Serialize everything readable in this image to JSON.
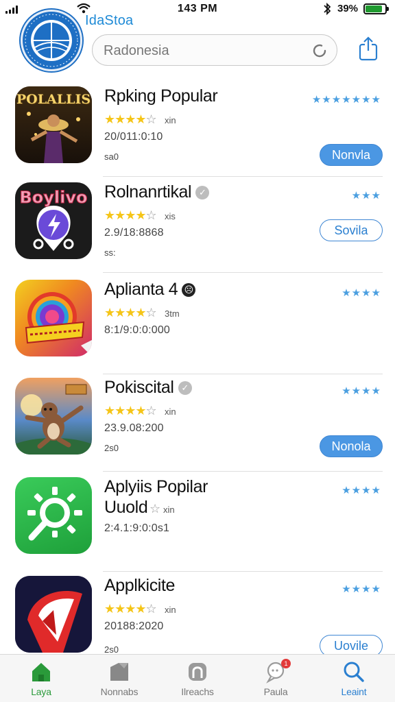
{
  "status_bar": {
    "time": "143 PM",
    "battery_percent": "39%",
    "battery_level": 0.85
  },
  "header": {
    "store_name": "IdaStoa"
  },
  "search": {
    "value": "Radonesia"
  },
  "apps": [
    {
      "name": "Rpking Popular",
      "name_line2": "",
      "rating_stars": 4,
      "rating_count": "xin",
      "meta": "20/011:0:10",
      "size": "sa0",
      "button": "Nonvla",
      "button_style": "filled",
      "icon": "app-icon-polallis",
      "icon_text": "POLALLIS",
      "right_stars": "★★★★★★★"
    },
    {
      "name": "Rolnanrtikal",
      "name_line2": "",
      "rating_stars": 4,
      "rating_count": "xis",
      "meta": "2.9/18:8868",
      "size": "ss:",
      "button": "Sovila",
      "button_style": "outline",
      "icon": "app-icon-boylivo",
      "icon_text": "Boylivo",
      "right_stars": "★★★"
    },
    {
      "name": "Aplianta 4",
      "name_line2": "",
      "rating_stars": 4,
      "rating_count": "3tm",
      "meta": "8:1/9:0:0:000",
      "size": "",
      "button": "",
      "button_style": "none",
      "icon": "app-icon-rainbow",
      "icon_text": "",
      "right_stars": "★★★★"
    },
    {
      "name": "Pokiscital",
      "name_line2": "",
      "rating_stars": 4,
      "rating_count": "xin",
      "meta": "23.9.08:200",
      "size": "2s0",
      "button": "Nonola",
      "button_style": "filled",
      "icon": "app-icon-bear",
      "icon_text": "",
      "right_stars": "★★★★"
    },
    {
      "name": "Aplyiis Popilar",
      "name_line2": "Uuold",
      "rating_stars": 0,
      "rating_count": "xin",
      "meta": "2:4.1:9:0:0s1",
      "size": "",
      "button": "",
      "button_style": "none",
      "icon": "app-icon-green-sun",
      "icon_text": "",
      "right_stars": "★★★★"
    },
    {
      "name": "Applkicite",
      "name_line2": "",
      "rating_stars": 4,
      "rating_count": "xin",
      "meta": "20188:2020",
      "size": "2s0",
      "button": "Uovile",
      "button_style": "outline",
      "icon": "app-icon-red-arrow",
      "icon_text": "",
      "right_stars": "★★★★"
    }
  ],
  "tabs": [
    {
      "label": "Laya",
      "icon": "home-icon",
      "active": true
    },
    {
      "label": "Nonnabs",
      "icon": "tag-icon",
      "active": false
    },
    {
      "label": "Ilreachs",
      "icon": "arch-icon",
      "active": false
    },
    {
      "label": "Paula",
      "icon": "chat-icon",
      "active": false,
      "badge": "1"
    },
    {
      "label": "Leaint",
      "icon": "search-icon",
      "active": false
    }
  ],
  "colors": {
    "accent": "#4b97e3",
    "active_tab": "#2a9a3a",
    "star": "#f5c518"
  }
}
